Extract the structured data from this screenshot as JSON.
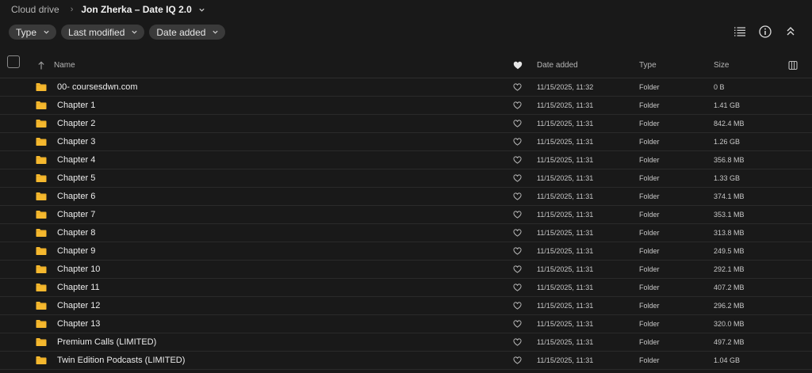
{
  "breadcrumb": {
    "root": "Cloud drive",
    "current": "Jon Zherka – Date IQ 2.0"
  },
  "filters": [
    {
      "label": "Type"
    },
    {
      "label": "Last modified"
    },
    {
      "label": "Date added"
    }
  ],
  "table": {
    "columns": {
      "name": "Name",
      "date_added": "Date added",
      "type": "Type",
      "size": "Size"
    },
    "rows": [
      {
        "name": "00- coursesdwn.com",
        "date": "11/15/2025, 11:32",
        "type": "Folder",
        "size": "0 B"
      },
      {
        "name": "Chapter 1",
        "date": "11/15/2025, 11:31",
        "type": "Folder",
        "size": "1.41 GB"
      },
      {
        "name": "Chapter 2",
        "date": "11/15/2025, 11:31",
        "type": "Folder",
        "size": "842.4 MB"
      },
      {
        "name": "Chapter 3",
        "date": "11/15/2025, 11:31",
        "type": "Folder",
        "size": "1.26 GB"
      },
      {
        "name": "Chapter 4",
        "date": "11/15/2025, 11:31",
        "type": "Folder",
        "size": "356.8 MB"
      },
      {
        "name": "Chapter 5",
        "date": "11/15/2025, 11:31",
        "type": "Folder",
        "size": "1.33 GB"
      },
      {
        "name": "Chapter 6",
        "date": "11/15/2025, 11:31",
        "type": "Folder",
        "size": "374.1 MB"
      },
      {
        "name": "Chapter 7",
        "date": "11/15/2025, 11:31",
        "type": "Folder",
        "size": "353.1 MB"
      },
      {
        "name": "Chapter 8",
        "date": "11/15/2025, 11:31",
        "type": "Folder",
        "size": "313.8 MB"
      },
      {
        "name": "Chapter 9",
        "date": "11/15/2025, 11:31",
        "type": "Folder",
        "size": "249.5 MB"
      },
      {
        "name": "Chapter 10",
        "date": "11/15/2025, 11:31",
        "type": "Folder",
        "size": "292.1 MB"
      },
      {
        "name": "Chapter 11",
        "date": "11/15/2025, 11:31",
        "type": "Folder",
        "size": "407.2 MB"
      },
      {
        "name": "Chapter 12",
        "date": "11/15/2025, 11:31",
        "type": "Folder",
        "size": "296.2 MB"
      },
      {
        "name": "Chapter 13",
        "date": "11/15/2025, 11:31",
        "type": "Folder",
        "size": "320.0 MB"
      },
      {
        "name": "Premium Calls (LIMITED)",
        "date": "11/15/2025, 11:31",
        "type": "Folder",
        "size": "497.2 MB"
      },
      {
        "name": "Twin Edition Podcasts (LIMITED)",
        "date": "11/15/2025, 11:31",
        "type": "Folder",
        "size": "1.04 GB"
      }
    ]
  },
  "icons": {
    "folder": "folder-icon",
    "heart": "heart-icon",
    "list_view": "list-view-icon",
    "info": "info-icon",
    "collapse": "collapse-icon",
    "columns": "columns-icon",
    "sort": "sort-arrow-icon",
    "chevron": "chevron-down-icon"
  },
  "colors": {
    "background": "#191919",
    "folder": "#f5b82e",
    "chip": "#3a3a3a",
    "text": "#e6e6e6",
    "muted": "#b5b5b5"
  }
}
